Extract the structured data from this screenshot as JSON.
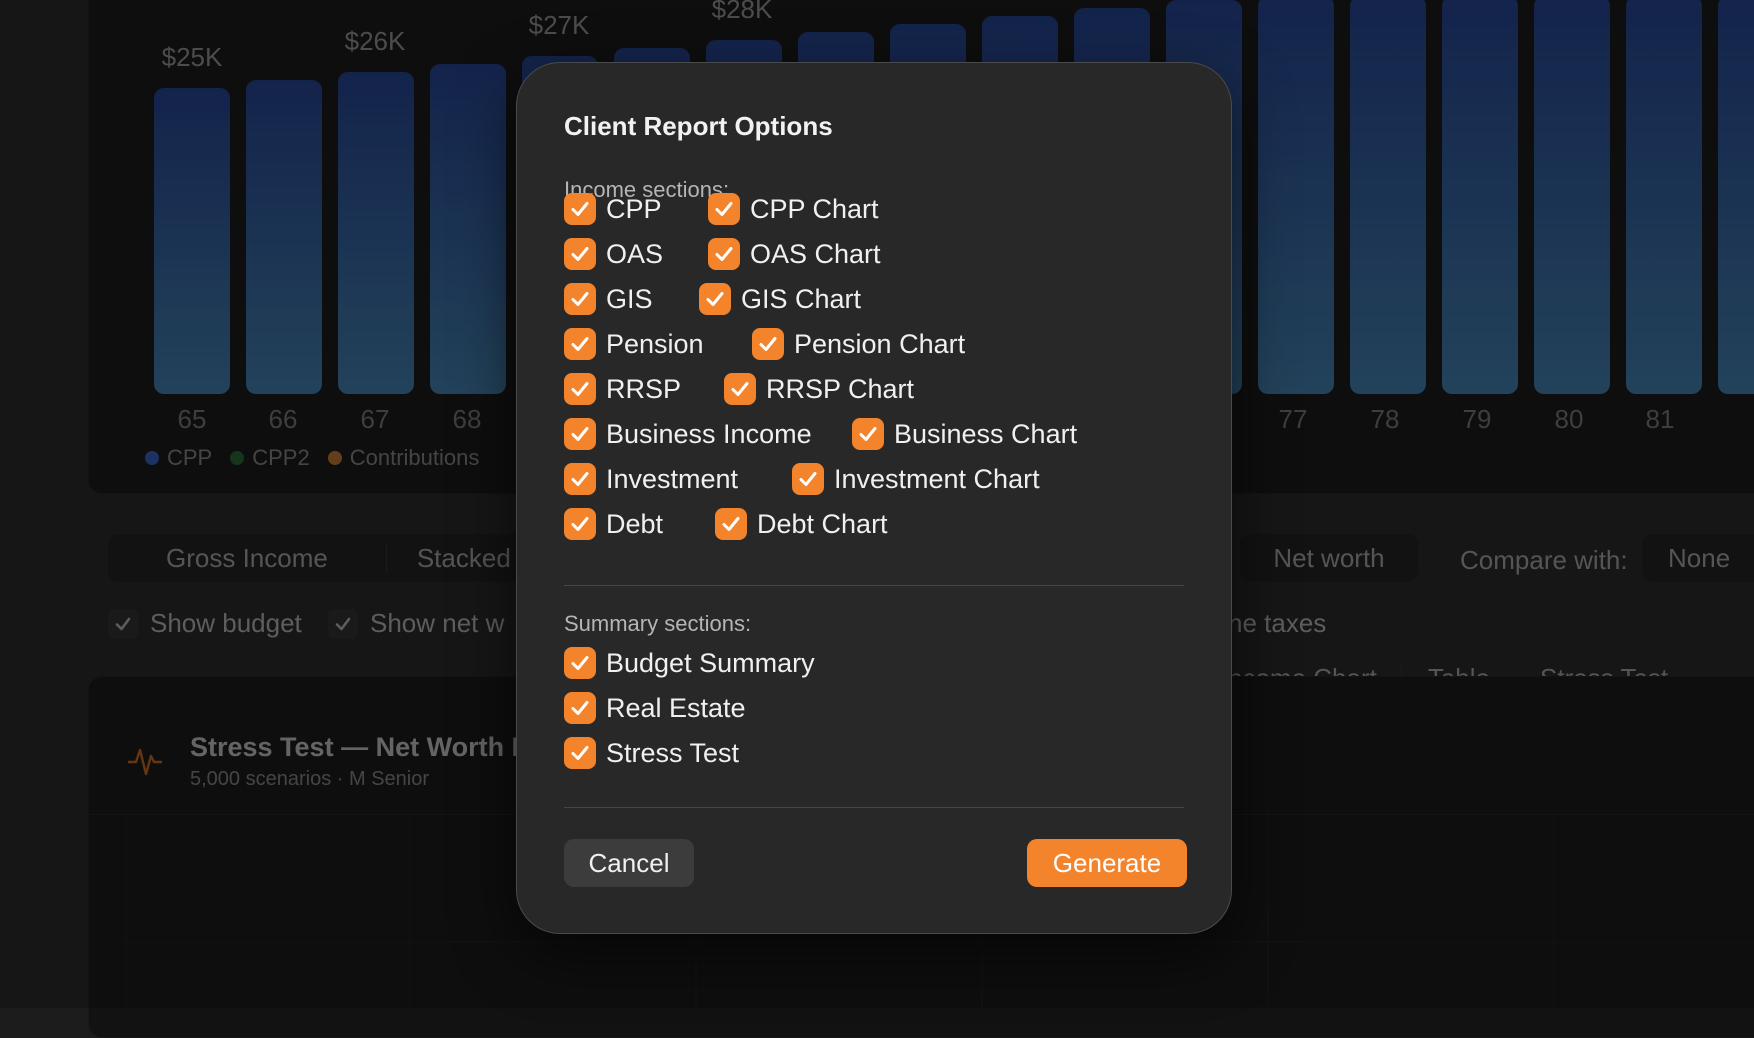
{
  "background": {
    "chart": {
      "value_labels": [
        "$25K",
        "$26K",
        "$27K",
        "$28K"
      ],
      "x_labels": [
        "65",
        "66",
        "67",
        "68",
        "77",
        "78",
        "79",
        "80",
        "81"
      ],
      "legend": [
        {
          "label": "CPP",
          "color": "#3f6fd8"
        },
        {
          "label": "CPP2",
          "color": "#2f7a3a"
        },
        {
          "label": "Contributions",
          "color": "#e08a3a"
        }
      ]
    },
    "view_tabs": {
      "gross_income": "Gross Income",
      "stacked": "Stacked",
      "net_worth": "Net worth"
    },
    "compare": {
      "label": "Compare with:",
      "value": "None"
    },
    "toggles": {
      "show_budget": "Show budget",
      "show_net": "Show net w",
      "taxes": "ne taxes"
    },
    "content_tabs": {
      "income_chart": "ncome Chart",
      "table": "Table",
      "stress_test": "Stress Test"
    },
    "stress_card": {
      "title": "Stress Test — Net Worth I",
      "subtitle": "5,000 scenarios · M Senior"
    }
  },
  "dialog": {
    "title": "Client Report Options",
    "income_label": "Income sections:",
    "income_options": [
      [
        "CPP",
        "CPP Chart"
      ],
      [
        "OAS",
        "OAS Chart"
      ],
      [
        "GIS",
        "GIS Chart"
      ],
      [
        "Pension",
        "Pension Chart"
      ],
      [
        "RRSP",
        "RRSP Chart"
      ],
      [
        "Business Income",
        "Business Chart"
      ],
      [
        "Investment",
        "Investment Chart"
      ],
      [
        "Debt",
        "Debt Chart"
      ]
    ],
    "summary_label": "Summary sections:",
    "summary_options": [
      "Budget Summary",
      "Real Estate",
      "Stress Test"
    ],
    "cancel_label": "Cancel",
    "generate_label": "Generate",
    "accent_color": "#f4842b"
  }
}
